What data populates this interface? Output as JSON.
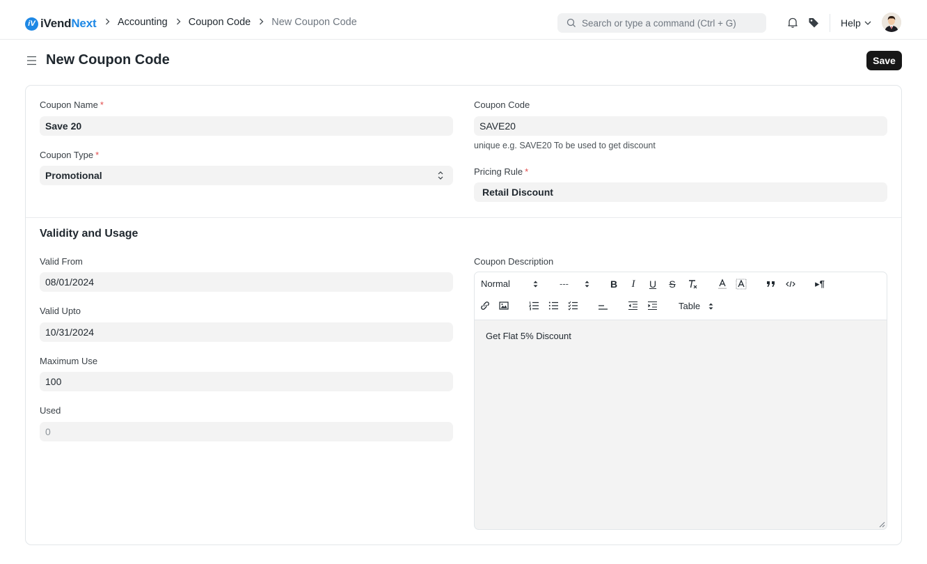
{
  "brand": {
    "name_part1": "iVend",
    "name_part2": "Next",
    "mark": "iV"
  },
  "breadcrumbs": [
    "Accounting",
    "Coupon Code",
    "New Coupon Code"
  ],
  "search": {
    "placeholder": "Search or type a command (Ctrl + G)"
  },
  "navbar": {
    "help_label": "Help",
    "icons": [
      "bell-icon",
      "tag-icon",
      "chevron-down-icon"
    ]
  },
  "page": {
    "title": "New Coupon Code",
    "save_label": "Save"
  },
  "form": {
    "coupon_name": {
      "label": "Coupon Name",
      "value": "Save 20",
      "required": true
    },
    "coupon_type": {
      "label": "Coupon Type",
      "value": "Promotional",
      "required": true
    },
    "coupon_code": {
      "label": "Coupon Code",
      "value": "SAVE20",
      "help": "unique e.g. SAVE20 To be used to get discount"
    },
    "pricing_rule": {
      "label": "Pricing Rule",
      "value": "Retail Discount",
      "required": true
    }
  },
  "validity": {
    "title": "Validity and Usage",
    "valid_from": {
      "label": "Valid From",
      "value": "08/01/2024"
    },
    "valid_upto": {
      "label": "Valid Upto",
      "value": "10/31/2024"
    },
    "maximum_use": {
      "label": "Maximum Use",
      "value": "100"
    },
    "used": {
      "label": "Used",
      "value": "0"
    },
    "description": {
      "label": "Coupon Description",
      "toolbar": {
        "text_style": "Normal",
        "font_size": "---",
        "table": "Table"
      },
      "content": "Get Flat 5% Discount"
    }
  },
  "colors": {
    "accent": "#1e88e5",
    "primary_button": "#171717",
    "required": "#e24c4c"
  }
}
